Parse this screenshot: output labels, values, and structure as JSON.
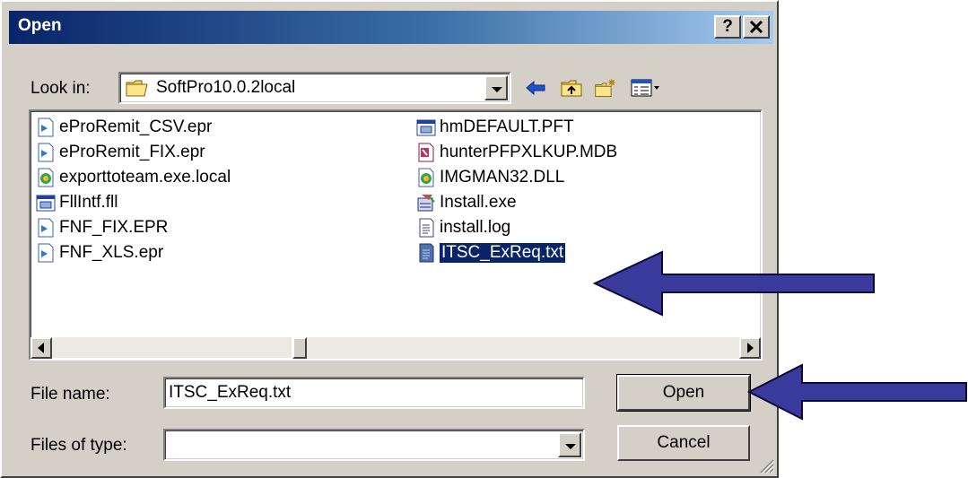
{
  "window": {
    "title": "Open",
    "help_label": "?",
    "close_label": "×"
  },
  "look_in": {
    "label": "Look in:",
    "value": "SoftPro10.0.2local"
  },
  "toolbar": {
    "back_icon": "back-arrow-icon",
    "up_icon": "up-folder-icon",
    "new_folder_icon": "new-folder-icon",
    "views_icon": "views-menu-icon"
  },
  "files": [
    {
      "name": "eProRemit_CSV.epr",
      "icon": "epr-file-icon"
    },
    {
      "name": "eProRemit_FIX.epr",
      "icon": "epr-file-icon"
    },
    {
      "name": "exporttoteam.exe.local",
      "icon": "local-file-icon"
    },
    {
      "name": "FllIntf.fll",
      "icon": "fll-file-icon"
    },
    {
      "name": "FNF_FIX.EPR",
      "icon": "epr-file-icon"
    },
    {
      "name": "FNF_XLS.epr",
      "icon": "epr-file-icon"
    },
    {
      "name": "hmDEFAULT.PFT",
      "icon": "pft-file-icon"
    },
    {
      "name": "hunterPFPXLKUP.MDB",
      "icon": "mdb-file-icon"
    },
    {
      "name": "IMGMAN32.DLL",
      "icon": "dll-file-icon"
    },
    {
      "name": "Install.exe",
      "icon": "exe-file-icon"
    },
    {
      "name": "install.log",
      "icon": "log-file-icon"
    },
    {
      "name": "ITSC_ExReq.txt",
      "icon": "txt-file-icon",
      "selected": true
    }
  ],
  "file_name": {
    "label": "File name:",
    "value": "ITSC_ExReq.txt"
  },
  "files_of_type": {
    "label": "Files of type:",
    "value": ""
  },
  "buttons": {
    "open": "Open",
    "cancel": "Cancel"
  },
  "colors": {
    "arrow": "#3a3a9c",
    "titlebar": "#0a246a",
    "selection": "#0a246a"
  }
}
